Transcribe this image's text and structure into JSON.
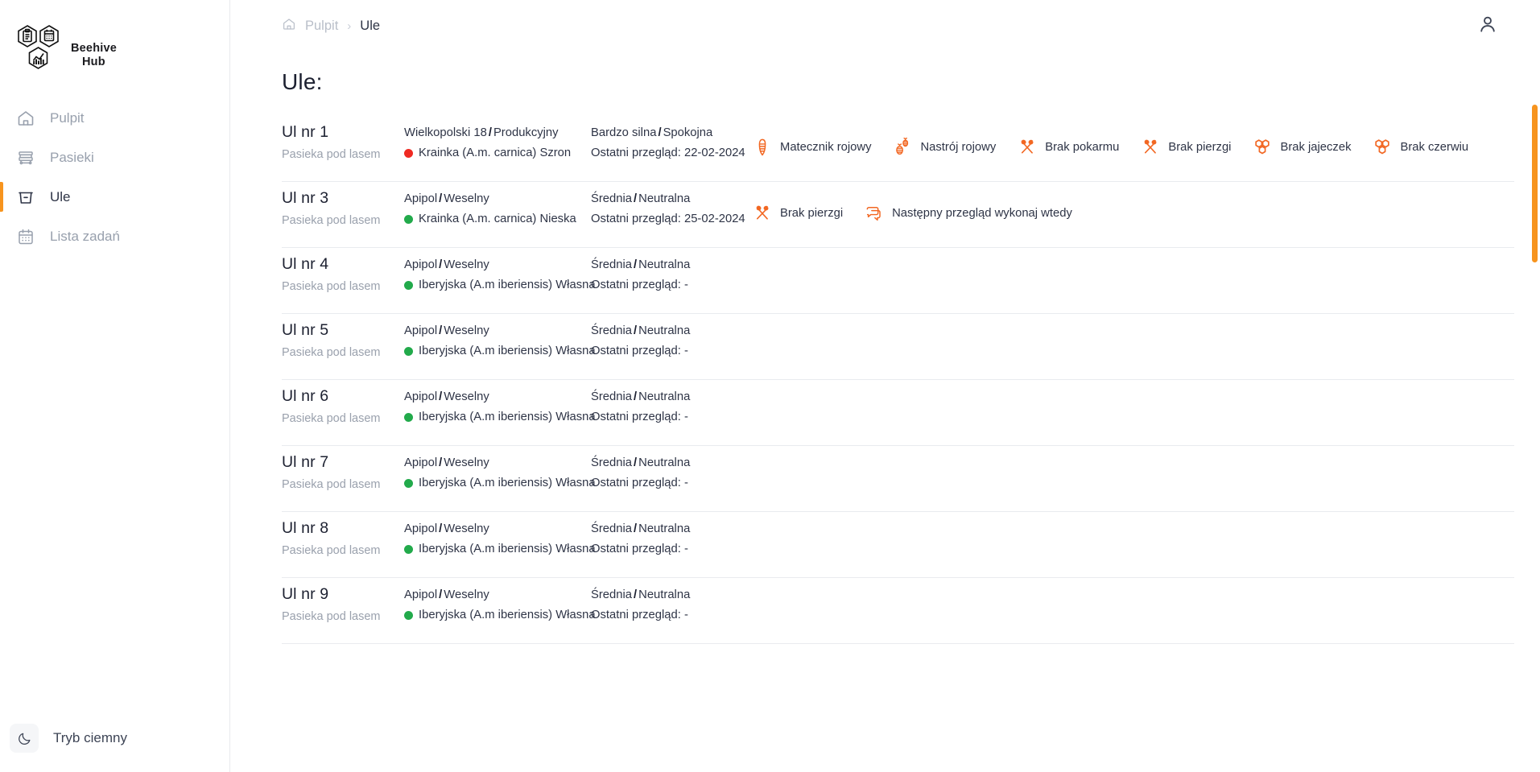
{
  "brand": {
    "name_line1": "Beehive",
    "name_line2": "Hub",
    "accent_color": "#f7941e"
  },
  "sidebar": {
    "items": [
      {
        "label": "Pulpit",
        "icon": "home-icon",
        "active": false
      },
      {
        "label": "Pasieki",
        "icon": "apiary-icon",
        "active": false
      },
      {
        "label": "Ule",
        "icon": "hive-icon",
        "active": true
      },
      {
        "label": "Lista zadań",
        "icon": "calendar-icon",
        "active": false
      }
    ],
    "dark_mode": {
      "label": "Tryb ciemny",
      "icon": "moon-icon"
    }
  },
  "topbar": {
    "breadcrumb": {
      "home_icon": "home-icon",
      "home_label": "Pulpit",
      "separator": "›",
      "current": "Ule"
    },
    "user_icon": "user-icon"
  },
  "page": {
    "title": "Ule:"
  },
  "colors": {
    "dot_red": "#ef2a22",
    "dot_green": "#22aa4b",
    "badge_orange": "#f26722",
    "text_dark": "#2e3446",
    "text_muted": "#9aa1ad"
  },
  "hives": [
    {
      "name": "Ul nr 1",
      "apiary": "Pasieka pod lasem",
      "type_left": "Wielkopolski 18",
      "type_right": "Produkcyjny",
      "breed": "Krainka (A.m. carnica) Szron",
      "breed_dot": "#ef2a22",
      "strength": "Bardzo silna",
      "temper": "Spokojna",
      "last_review": "Ostatni przegląd: 22-02-2024",
      "badges": [
        {
          "label": "Matecznik rojowy",
          "icon": "queen-cell-icon"
        },
        {
          "label": "Nastrój rojowy",
          "icon": "swarm-mood-icon"
        },
        {
          "label": "Brak pokarmu",
          "icon": "no-food-icon"
        },
        {
          "label": "Brak pierzgi",
          "icon": "no-beebread-icon"
        },
        {
          "label": "Brak jajeczek",
          "icon": "no-eggs-icon"
        },
        {
          "label": "Brak czerwiu",
          "icon": "no-brood-icon"
        }
      ]
    },
    {
      "name": "Ul nr 3",
      "apiary": "Pasieka pod lasem",
      "type_left": "Apipol",
      "type_right": "Weselny",
      "breed": "Krainka (A.m. carnica) Nieska",
      "breed_dot": "#22aa4b",
      "strength": "Średnia",
      "temper": "Neutralna",
      "last_review": "Ostatni przegląd: 25-02-2024",
      "badges": [
        {
          "label": "Brak pierzgi",
          "icon": "no-beebread-icon"
        },
        {
          "label": "Następny przegląd wykonaj wtedy",
          "icon": "note-icon"
        }
      ]
    },
    {
      "name": "Ul nr 4",
      "apiary": "Pasieka pod lasem",
      "type_left": "Apipol",
      "type_right": "Weselny",
      "breed": "Iberyjska (A.m iberiensis) Własna",
      "breed_dot": "#22aa4b",
      "strength": "Średnia",
      "temper": "Neutralna",
      "last_review": "Ostatni przegląd: -",
      "badges": []
    },
    {
      "name": "Ul nr 5",
      "apiary": "Pasieka pod lasem",
      "type_left": "Apipol",
      "type_right": "Weselny",
      "breed": "Iberyjska (A.m iberiensis) Własna",
      "breed_dot": "#22aa4b",
      "strength": "Średnia",
      "temper": "Neutralna",
      "last_review": "Ostatni przegląd: -",
      "badges": []
    },
    {
      "name": "Ul nr 6",
      "apiary": "Pasieka pod lasem",
      "type_left": "Apipol",
      "type_right": "Weselny",
      "breed": "Iberyjska (A.m iberiensis) Własna",
      "breed_dot": "#22aa4b",
      "strength": "Średnia",
      "temper": "Neutralna",
      "last_review": "Ostatni przegląd: -",
      "badges": []
    },
    {
      "name": "Ul nr 7",
      "apiary": "Pasieka pod lasem",
      "type_left": "Apipol",
      "type_right": "Weselny",
      "breed": "Iberyjska (A.m iberiensis) Własna",
      "breed_dot": "#22aa4b",
      "strength": "Średnia",
      "temper": "Neutralna",
      "last_review": "Ostatni przegląd: -",
      "badges": []
    },
    {
      "name": "Ul nr 8",
      "apiary": "Pasieka pod lasem",
      "type_left": "Apipol",
      "type_right": "Weselny",
      "breed": "Iberyjska (A.m iberiensis) Własna",
      "breed_dot": "#22aa4b",
      "strength": "Średnia",
      "temper": "Neutralna",
      "last_review": "Ostatni przegląd: -",
      "badges": []
    },
    {
      "name": "Ul nr 9",
      "apiary": "Pasieka pod lasem",
      "type_left": "Apipol",
      "type_right": "Weselny",
      "breed": "Iberyjska (A.m iberiensis) Własna",
      "breed_dot": "#22aa4b",
      "strength": "Średnia",
      "temper": "Neutralna",
      "last_review": "Ostatni przegląd: -",
      "badges": []
    }
  ],
  "scrollbar": {
    "color": "#f7941e"
  }
}
